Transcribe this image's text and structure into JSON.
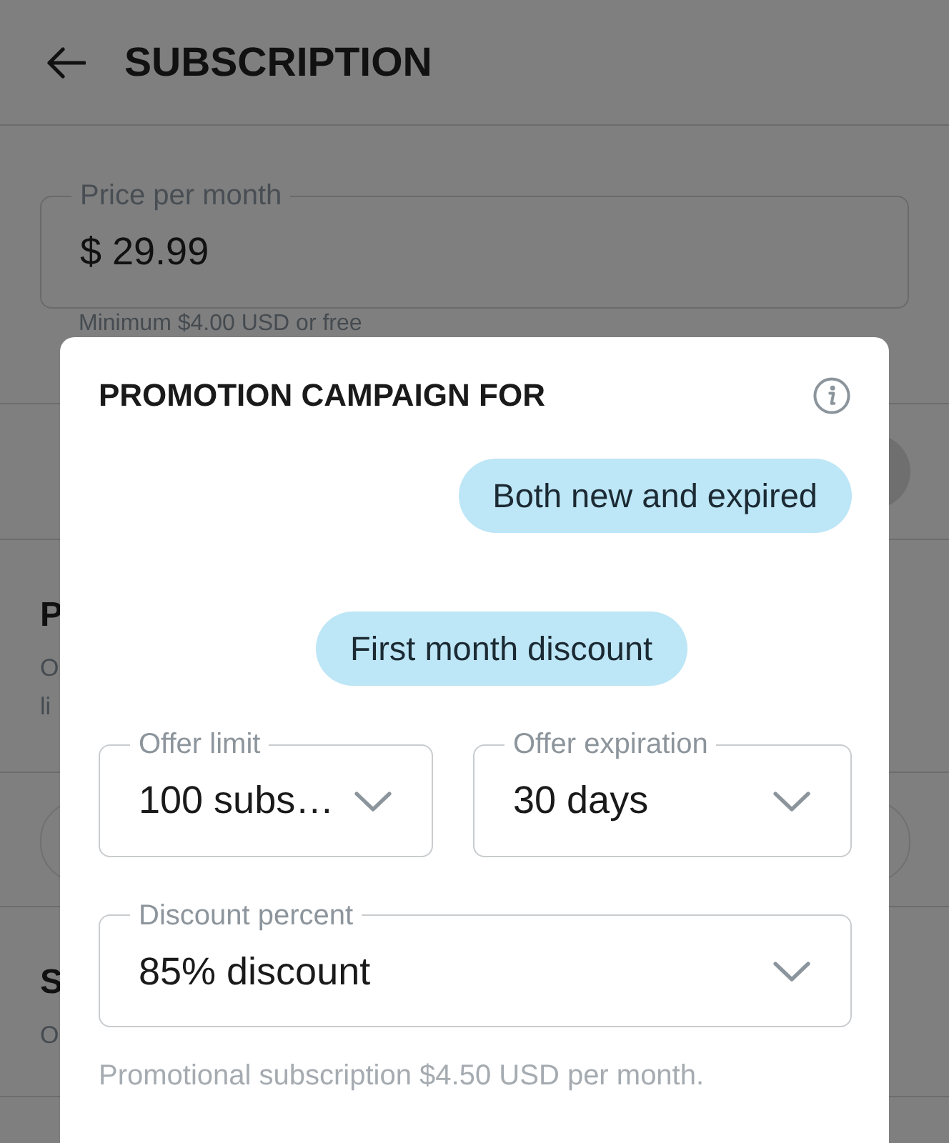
{
  "screen": {
    "title": "SUBSCRIPTION"
  },
  "price_field": {
    "label": "Price per month",
    "value": "$ 29.99",
    "hint": "Minimum $4.00 USD or free"
  },
  "background_sections": [
    {
      "kind": "round_button"
    },
    {
      "kind": "text",
      "heading": "P",
      "lines": [
        "O",
        "li"
      ]
    },
    {
      "kind": "outlined_button"
    },
    {
      "kind": "text",
      "heading": "S",
      "lines": [
        "O"
      ]
    }
  ],
  "dialog": {
    "title": "PROMOTION CAMPAIGN FOR",
    "chips": [
      {
        "label": "Both new and expired"
      },
      {
        "label": "First month discount"
      }
    ],
    "selects": [
      {
        "label": "Offer limit",
        "value": "100 subs…"
      },
      {
        "label": "Offer expiration",
        "value": "30 days"
      },
      {
        "label": "Discount percent",
        "value": "85% discount"
      }
    ],
    "note": "Promotional subscription $4.50 USD per month."
  }
}
